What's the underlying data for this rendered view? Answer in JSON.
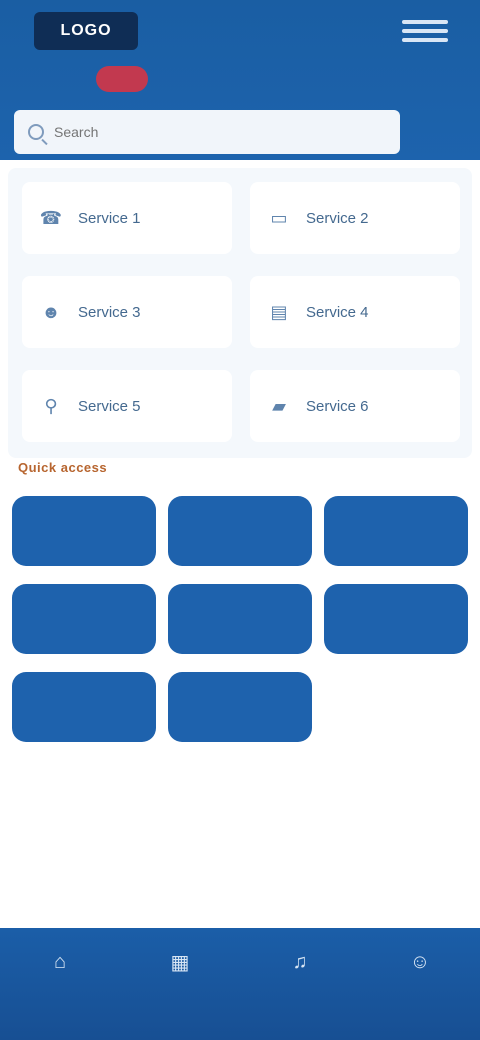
{
  "header": {
    "logo_text": "LOGO",
    "language_label": "",
    "menu_icon": "hamburger-icon"
  },
  "search": {
    "placeholder": "Search",
    "icon": "search-icon"
  },
  "services": [
    {
      "label": "Service 1",
      "icon": "phone-icon"
    },
    {
      "label": "Service 2",
      "icon": "card-icon"
    },
    {
      "label": "Service 3",
      "icon": "person-icon"
    },
    {
      "label": "Service 4",
      "icon": "document-icon"
    },
    {
      "label": "Service 5",
      "icon": "location-icon"
    },
    {
      "label": "Service 6",
      "icon": "car-icon"
    }
  ],
  "section_title": "Quick access",
  "tiles": [
    {
      "label": ""
    },
    {
      "label": ""
    },
    {
      "label": ""
    },
    {
      "label": ""
    },
    {
      "label": ""
    },
    {
      "label": ""
    },
    {
      "label": ""
    },
    {
      "label": ""
    }
  ],
  "bottom_nav": [
    {
      "label": "",
      "icon": "home-icon"
    },
    {
      "label": "",
      "icon": "grid-icon"
    },
    {
      "label": "",
      "icon": "bell-icon"
    },
    {
      "label": "",
      "icon": "user-icon"
    }
  ],
  "colors": {
    "primary": "#1e62ad",
    "header": "#1a5ea3",
    "accent": "#c2394f",
    "section_title": "#b7652f"
  }
}
